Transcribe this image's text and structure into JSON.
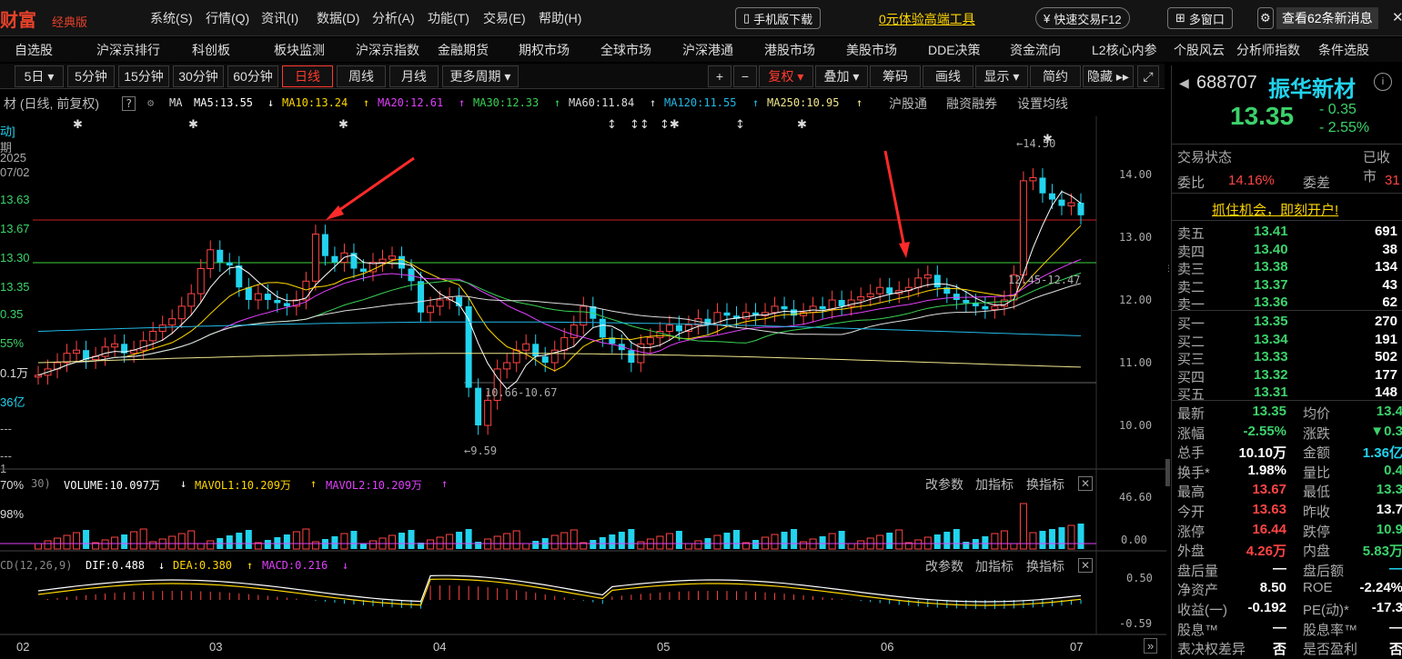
{
  "app": {
    "logo": "财富",
    "logo_sub": "经典版",
    "menu": [
      "系统(S)",
      "行情(Q)",
      "资讯(I)",
      "数据(D)",
      "分析(A)",
      "功能(T)",
      "交易(E)",
      "帮助(H)"
    ],
    "mobile_download": "手机版下载",
    "promo": "0元体验高端工具",
    "quick_trade": "快速交易F12",
    "multi_window": "多窗口",
    "news": "查看62条新消息"
  },
  "nav": {
    "items": [
      "自选股",
      "沪深京排行",
      "科创板",
      "板块监测",
      "沪深京指数",
      "金融期货",
      "期权市场",
      "全球市场",
      "沪深港通",
      "港股市场",
      "美股市场",
      "DDE决策",
      "资金流向",
      "L2核心内参",
      "个股风云",
      "分析师指数",
      "条件选股"
    ]
  },
  "toolbar": {
    "period": "5日",
    "buttons": [
      "5分钟",
      "15分钟",
      "30分钟",
      "60分钟",
      "日线",
      "周线",
      "月线",
      "更多周期"
    ],
    "active": "日线",
    "plus": "+",
    "minus": "−",
    "fuquan": "复权",
    "diejia": "叠加",
    "chouma": "筹码",
    "huaxian": "画线",
    "xianshi": "显示",
    "jianyue": "简约",
    "yincang": "隐藏"
  },
  "ma_line": {
    "prefix": "材 (日线, 前复权)",
    "help": "?",
    "ma_label": "MA",
    "ma5": "MA5:13.55",
    "ma10": "MA10:13.24",
    "ma20": "MA20:12.61",
    "ma30": "MA30:12.33",
    "ma60": "MA60:11.84",
    "ma120": "MA120:11.55",
    "ma250": "MA250:10.95",
    "husgt": "沪股通",
    "rongzi": "融资融券",
    "setma": "设置均线"
  },
  "left_strip": {
    "items": [
      "动]",
      "期",
      "2025",
      "07/02",
      "13.63",
      "13.67",
      "13.30",
      "13.35",
      "0.35",
      "55%",
      "0.1万",
      "36亿",
      "---",
      "---",
      "1",
      "70%",
      "98%"
    ]
  },
  "annotations": {
    "high": "14.50",
    "low": "9.59",
    "range1": "10.66-10.67",
    "range2": "12.45-12.47"
  },
  "price_axis": [
    "14.00",
    "13.00",
    "12.00",
    "11.00",
    "10.00"
  ],
  "volume": {
    "head": "30)",
    "label": "VOLUME:10.097万",
    "mavol1": "MAVOL1:10.209万",
    "mavol2": "MAVOL2:10.209万",
    "axis": [
      "46.60",
      "0.00"
    ],
    "btns": [
      "改参数",
      "加指标",
      "换指标"
    ]
  },
  "macd": {
    "head": "CD(12,26,9)",
    "dif": "DIF:0.488",
    "dea": "DEA:0.380",
    "macd": "MACD:0.216",
    "axis": [
      "0.50",
      "-0.59"
    ],
    "btns": [
      "改参数",
      "加指标",
      "换指标"
    ]
  },
  "x_labels": [
    "02",
    "03",
    "04",
    "05",
    "06",
    "07"
  ],
  "quote": {
    "code": "688707",
    "name": "振华新材",
    "price": "13.35",
    "change": "- 0.35",
    "change_pct": "- 2.55%",
    "status_label": "交易状态",
    "status_value": "已收市",
    "weibi_label": "委比",
    "weibi_value": "14.16%",
    "weicha_label": "委差",
    "weicha_value": "31",
    "open_account": "抓住机会，即刻开户!",
    "asks": [
      {
        "label": "卖五",
        "price": "13.41",
        "vol": "691"
      },
      {
        "label": "卖四",
        "price": "13.40",
        "vol": "38"
      },
      {
        "label": "卖三",
        "price": "13.38",
        "vol": "134"
      },
      {
        "label": "卖二",
        "price": "13.37",
        "vol": "43"
      },
      {
        "label": "卖一",
        "price": "13.36",
        "vol": "62"
      }
    ],
    "bids": [
      {
        "label": "买一",
        "price": "13.35",
        "vol": "270"
      },
      {
        "label": "买二",
        "price": "13.34",
        "vol": "191"
      },
      {
        "label": "买三",
        "price": "13.33",
        "vol": "502"
      },
      {
        "label": "买四",
        "price": "13.32",
        "vol": "177"
      },
      {
        "label": "买五",
        "price": "13.31",
        "vol": "148"
      }
    ],
    "stats": [
      {
        "l1": "最新",
        "v1": "13.35",
        "l2": "均价",
        "v2": "13.4"
      },
      {
        "l1": "涨幅",
        "v1": "-2.55%",
        "l2": "涨跌",
        "v2": "▼0.3"
      },
      {
        "l1": "总手",
        "v1": "10.10万",
        "l2": "金额",
        "v2": "1.36亿"
      },
      {
        "l1": "换手*",
        "v1": "1.98%",
        "l2": "量比",
        "v2": "0.4"
      },
      {
        "l1": "最高",
        "v1": "13.67",
        "l2": "最低",
        "v2": "13.3"
      },
      {
        "l1": "今开",
        "v1": "13.63",
        "l2": "昨收",
        "v2": "13.7"
      },
      {
        "l1": "涨停",
        "v1": "16.44",
        "l2": "跌停",
        "v2": "10.9"
      },
      {
        "l1": "外盘",
        "v1": "4.26万",
        "l2": "内盘",
        "v2": "5.83万"
      },
      {
        "l1": "盘后量",
        "v1": "—",
        "l2": "盘后额",
        "v2": "—"
      },
      {
        "l1": "净资产",
        "v1": "8.50",
        "l2": "ROE",
        "v2": "-2.24%"
      },
      {
        "l1": "收益(一)",
        "v1": "-0.192",
        "l2": "PE(动)*",
        "v2": "-17.3"
      },
      {
        "l1": "股息™",
        "v1": "—",
        "l2": "股息率™",
        "v2": "—"
      },
      {
        "l1": "表决权差异",
        "v1": "否",
        "l2": "是否盈利",
        "v2": "否"
      }
    ]
  },
  "colors": {
    "up": "#ff4444",
    "down": "#22d3ee",
    "ma5": "#ffffff",
    "ma10": "#ffd700",
    "ma20": "#e040fb",
    "ma30": "#39d353",
    "ma60": "#dddddd",
    "ma120": "#22b8e6",
    "ma250": "#f0e68c"
  }
}
